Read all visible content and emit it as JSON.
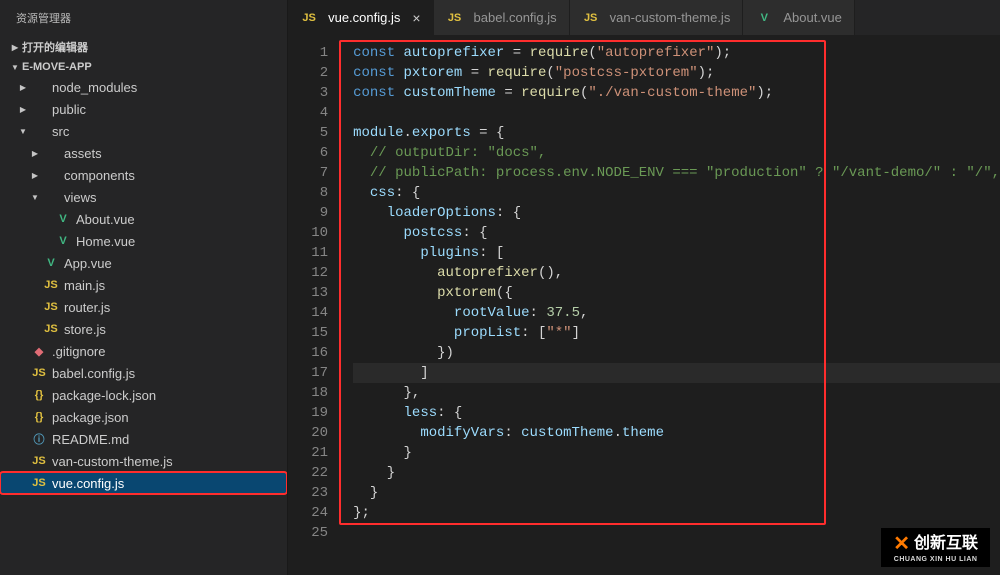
{
  "sidebar": {
    "title": "资源管理器",
    "sections": {
      "openEditors": "打开的编辑器",
      "project": "E-MOVE-APP"
    },
    "tree": [
      {
        "label": "node_modules",
        "icon": "folder",
        "chev": "right",
        "indent": 1
      },
      {
        "label": "public",
        "icon": "folder",
        "chev": "right",
        "indent": 1
      },
      {
        "label": "src",
        "icon": "folder",
        "chev": "down",
        "indent": 1
      },
      {
        "label": "assets",
        "icon": "folder",
        "chev": "right",
        "indent": 2
      },
      {
        "label": "components",
        "icon": "folder",
        "chev": "right",
        "indent": 2
      },
      {
        "label": "views",
        "icon": "folder",
        "chev": "down",
        "indent": 2
      },
      {
        "label": "About.vue",
        "icon": "vue",
        "chev": "none",
        "indent": 3
      },
      {
        "label": "Home.vue",
        "icon": "vue",
        "chev": "none",
        "indent": 3
      },
      {
        "label": "App.vue",
        "icon": "vue",
        "chev": "none",
        "indent": 2
      },
      {
        "label": "main.js",
        "icon": "js",
        "chev": "none",
        "indent": 2
      },
      {
        "label": "router.js",
        "icon": "js",
        "chev": "none",
        "indent": 2
      },
      {
        "label": "store.js",
        "icon": "js",
        "chev": "none",
        "indent": 2
      },
      {
        "label": ".gitignore",
        "icon": "git",
        "chev": "none",
        "indent": 1
      },
      {
        "label": "babel.config.js",
        "icon": "js",
        "chev": "none",
        "indent": 1
      },
      {
        "label": "package-lock.json",
        "icon": "json",
        "chev": "none",
        "indent": 1
      },
      {
        "label": "package.json",
        "icon": "json",
        "chev": "none",
        "indent": 1
      },
      {
        "label": "README.md",
        "icon": "md",
        "chev": "none",
        "indent": 1
      },
      {
        "label": "van-custom-theme.js",
        "icon": "js",
        "chev": "none",
        "indent": 1
      },
      {
        "label": "vue.config.js",
        "icon": "js",
        "chev": "none",
        "indent": 1,
        "selected": true,
        "highlight": true
      }
    ]
  },
  "tabs": [
    {
      "label": "vue.config.js",
      "icon": "js",
      "active": true,
      "close": "×"
    },
    {
      "label": "babel.config.js",
      "icon": "js",
      "active": false
    },
    {
      "label": "van-custom-theme.js",
      "icon": "js",
      "active": false
    },
    {
      "label": "About.vue",
      "icon": "vue",
      "active": false
    }
  ],
  "editor": {
    "lineCount": 25,
    "cursorLine": 17,
    "code": [
      [
        [
          "kw",
          "const"
        ],
        [
          "pun",
          " "
        ],
        [
          "var",
          "autoprefixer"
        ],
        [
          "pun",
          " = "
        ],
        [
          "fn",
          "require"
        ],
        [
          "pun",
          "("
        ],
        [
          "str",
          "\"autoprefixer\""
        ],
        [
          "pun",
          ");"
        ]
      ],
      [
        [
          "kw",
          "const"
        ],
        [
          "pun",
          " "
        ],
        [
          "var",
          "pxtorem"
        ],
        [
          "pun",
          " = "
        ],
        [
          "fn",
          "require"
        ],
        [
          "pun",
          "("
        ],
        [
          "str",
          "\"postcss-pxtorem\""
        ],
        [
          "pun",
          ");"
        ]
      ],
      [
        [
          "kw",
          "const"
        ],
        [
          "pun",
          " "
        ],
        [
          "var",
          "customTheme"
        ],
        [
          "pun",
          " = "
        ],
        [
          "fn",
          "require"
        ],
        [
          "pun",
          "("
        ],
        [
          "str",
          "\"./van-custom-theme\""
        ],
        [
          "pun",
          ");"
        ]
      ],
      [],
      [
        [
          "var",
          "module"
        ],
        [
          "pun",
          "."
        ],
        [
          "var",
          "exports"
        ],
        [
          "pun",
          " = {"
        ]
      ],
      [
        [
          "cmt",
          "  // outputDir: \"docs\","
        ]
      ],
      [
        [
          "cmt",
          "  // publicPath: process.env.NODE_ENV === \"production\" ? \"/vant-demo/\" : \"/\","
        ]
      ],
      [
        [
          "pun",
          "  "
        ],
        [
          "prop",
          "css"
        ],
        [
          "pun",
          ": {"
        ]
      ],
      [
        [
          "pun",
          "    "
        ],
        [
          "prop",
          "loaderOptions"
        ],
        [
          "pun",
          ": {"
        ]
      ],
      [
        [
          "pun",
          "      "
        ],
        [
          "prop",
          "postcss"
        ],
        [
          "pun",
          ": {"
        ]
      ],
      [
        [
          "pun",
          "        "
        ],
        [
          "prop",
          "plugins"
        ],
        [
          "pun",
          ": ["
        ]
      ],
      [
        [
          "pun",
          "          "
        ],
        [
          "fn",
          "autoprefixer"
        ],
        [
          "pun",
          "(),"
        ]
      ],
      [
        [
          "pun",
          "          "
        ],
        [
          "fn",
          "pxtorem"
        ],
        [
          "pun",
          "({"
        ]
      ],
      [
        [
          "pun",
          "            "
        ],
        [
          "prop",
          "rootValue"
        ],
        [
          "pun",
          ": "
        ],
        [
          "num",
          "37.5"
        ],
        [
          "pun",
          ","
        ]
      ],
      [
        [
          "pun",
          "            "
        ],
        [
          "prop",
          "propList"
        ],
        [
          "pun",
          ": ["
        ],
        [
          "str",
          "\"*\""
        ],
        [
          "pun",
          "]"
        ]
      ],
      [
        [
          "pun",
          "          })"
        ]
      ],
      [
        [
          "pun",
          "        ]"
        ]
      ],
      [
        [
          "pun",
          "      },"
        ]
      ],
      [
        [
          "pun",
          "      "
        ],
        [
          "prop",
          "less"
        ],
        [
          "pun",
          ": {"
        ]
      ],
      [
        [
          "pun",
          "        "
        ],
        [
          "prop",
          "modifyVars"
        ],
        [
          "pun",
          ": "
        ],
        [
          "var",
          "customTheme"
        ],
        [
          "pun",
          "."
        ],
        [
          "var",
          "theme"
        ]
      ],
      [
        [
          "pun",
          "      }"
        ]
      ],
      [
        [
          "pun",
          "    }"
        ]
      ],
      [
        [
          "pun",
          "  }"
        ]
      ],
      [
        [
          "pun",
          "};"
        ]
      ],
      []
    ]
  },
  "watermark": {
    "brand": "创新互联",
    "sub": "CHUANG XIN HU LIAN"
  }
}
